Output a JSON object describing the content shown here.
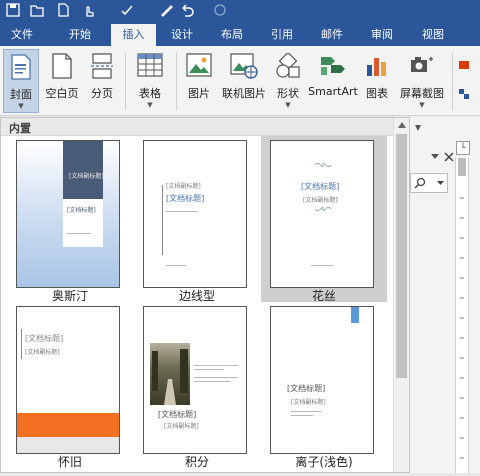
{
  "ribbon_tabs": [
    "文件",
    "开始",
    "插入",
    "设计",
    "布局",
    "引用",
    "邮件",
    "审阅",
    "视图"
  ],
  "active_tab": "插入",
  "ribbon": {
    "cover": "封面",
    "blank_page": "空白页",
    "page_break": "分页",
    "table": "表格",
    "picture": "图片",
    "online_picture": "联机图片",
    "shapes": "形状",
    "smartart": "SmartArt",
    "chart": "图表",
    "screenshot": "屏幕截图"
  },
  "gallery": {
    "section_title": "内置",
    "items": [
      {
        "caption": "奥斯汀",
        "doc_title": "[文档标题]",
        "note": "[文档副标题]"
      },
      {
        "caption": "边线型",
        "doc_title": "[文档标题]",
        "note": "[文档副标题]"
      },
      {
        "caption": "花丝",
        "doc_title": "[文档标题]",
        "note": "[文档副标题]"
      },
      {
        "caption": "怀旧",
        "doc_title": "[文档标题]",
        "note": "[文档副标题]"
      },
      {
        "caption": "积分",
        "doc_title": "[文档标题]",
        "note": "[文档副标题]"
      },
      {
        "caption": "离子(浅色)",
        "doc_title": "[文档标题]",
        "note": "[文档副标题]"
      }
    ]
  },
  "colors": {
    "accent": "#2b579a",
    "ribbon_bg": "#f3f3f3",
    "selected_cell": "#cfcfcf",
    "orange": "#f36f21",
    "austin_dark": "#495c77",
    "ion_blue": "#5b9bd5"
  },
  "icons": [
    "save-icon",
    "undo-icon",
    "redo-icon",
    "close-icon",
    "search-icon"
  ]
}
